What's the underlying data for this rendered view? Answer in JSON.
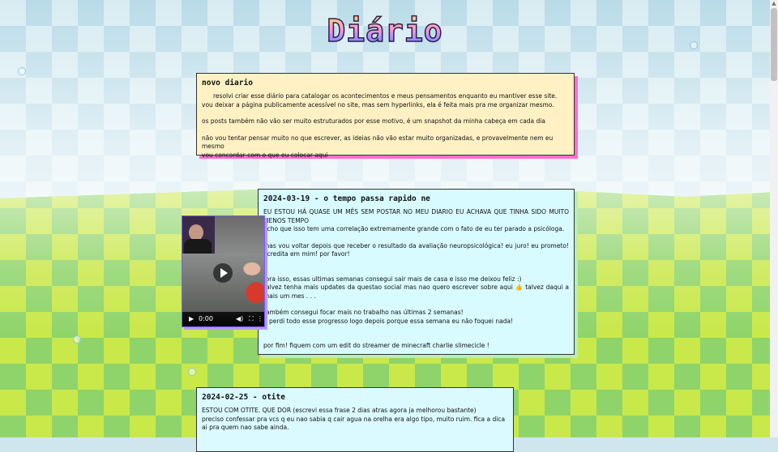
{
  "page": {
    "title": "Diário"
  },
  "colors": {
    "title_gradient_top": "#ffe066",
    "title_gradient_mid": "#ff9ad5",
    "title_gradient_bottom": "#6fb6ff",
    "card_yellow": "#fff1c4",
    "card_cyan": "#d8fbff",
    "shadow_pink": "#ff6fcf"
  },
  "posts": [
    {
      "title": "novo diario",
      "paragraphs": [
        "resolvi criar esse diário para catalogar os acontecimentos e meus pensamentos enquanto eu mantiver esse site.",
        "vou deixar a página publicamente acessível no site, mas sem hyperlinks, ela é feita mais pra me organizar mesmo.",
        "os posts também não vão ser muito estruturados por esse motivo, é um snapshot da minha cabeça em cada dia",
        "não vou tentar pensar muito no que escrever, as ideias não vão estar muito organizadas, e provavelmente nem eu mesmo",
        "vou concordar com o que eu colocar aqui"
      ]
    },
    {
      "title": "2024-03-19 - o tempo passa rapido ne",
      "paragraphs": [
        "EU ESTOU HÁ QUASE UM MÊS SEM POSTAR NO MEU DIARIO EU ACHAVA QUE TINHA SIDO MUITO MENOS TEMPO",
        "acho que isso tem uma correlação extremamente grande com o fato de eu ter parado a psicóloga.",
        "mas vou voltar depois que receber o resultado da avaliação neuropsicológica! eu juro! eu prometo! acredita em mim! por favor!",
        "fora isso, essas ultimas semanas consegui sair mais de casa e isso me deixou feliz :)",
        "talvez tenha mais updates da questao social mas nao quero escrever sobre aqui 👍 talvez daqui a mais um mes . . .",
        "também consegui focar mais no trabalho nas últimas 2 semanas!",
        "e perdi todo esse progresso logo depois porque essa semana eu não foquei nada!",
        "por fim! fiquem com um edit do streamer de minecraft charlie slimecicle !"
      ],
      "video": {
        "time": "0:00"
      }
    },
    {
      "title": "2024-02-25 - otite",
      "paragraphs": [
        "ESTOU COM OTITE. QUE DOR (escrevi essa frase 2 dias atras agora ja melhorou bastante)",
        "preciso confessar pra vcs q eu nao sabia q cair agua na orelha era algo tipo, muito ruim. fica a dica ai pra quem nao sabe ainda."
      ]
    }
  ],
  "icons": {
    "play": "play-icon",
    "volume": "volume-icon",
    "fullscreen": "fullscreen-icon",
    "menu": "more-vert-icon"
  }
}
